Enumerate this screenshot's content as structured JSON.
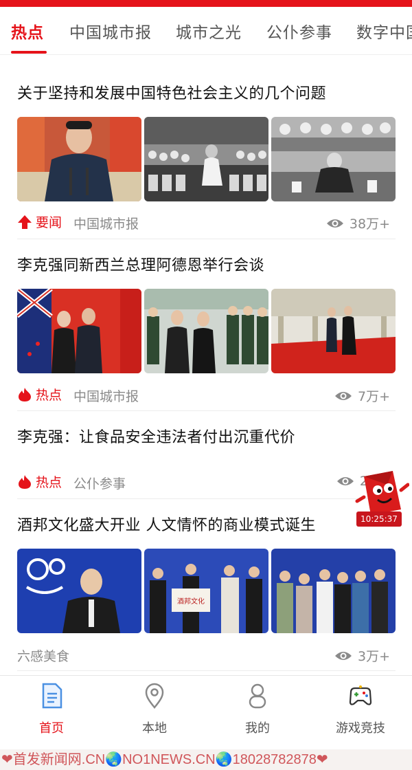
{
  "colors": {
    "accent": "#e5131a",
    "text": "#111111",
    "meta": "#8a8a8a"
  },
  "tabs": [
    {
      "label": "热点",
      "active": true
    },
    {
      "label": "中国城市报"
    },
    {
      "label": "城市之光"
    },
    {
      "label": "公仆参事"
    },
    {
      "label": "数字中国"
    }
  ],
  "articles": [
    {
      "title": "关于坚持和发展中国特色社会主义的几个问题",
      "tag": "要闻",
      "tag_icon": "arrow-up-icon",
      "source": "中国城市报",
      "views": "38万+"
    },
    {
      "title": "李克强同新西兰总理阿德恩举行会谈",
      "tag": "热点",
      "tag_icon": "flame-icon",
      "source": "中国城市报",
      "views": "7万+"
    },
    {
      "title": "李克强：让食品安全违法者付出沉重代价",
      "tag": "热点",
      "tag_icon": "flame-icon",
      "source": "公仆参事",
      "views": "2"
    },
    {
      "title": "酒邦文化盛大开业 人文情怀的商业模式诞生",
      "tag": "",
      "source": "六感美食",
      "views": "3万+",
      "thumb_sign": "酒邦文化"
    }
  ],
  "floating": {
    "timer": "10:25:37",
    "icon": "red-envelope-mascot-icon"
  },
  "bottom_nav": [
    {
      "label": "首页",
      "icon": "document-icon",
      "active": true
    },
    {
      "label": "本地",
      "icon": "location-pin-icon"
    },
    {
      "label": "我的",
      "icon": "person-icon"
    },
    {
      "label": "游戏竞技",
      "icon": "gamepad-icon"
    }
  ],
  "watermark": "❤首发新闻网.CN🌏NO1NEWS.CN🌏18028782878❤"
}
